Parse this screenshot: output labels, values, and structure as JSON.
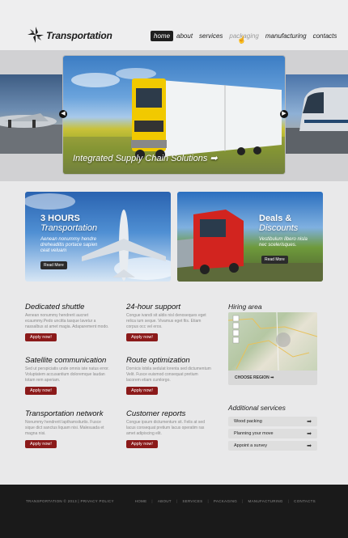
{
  "brand": {
    "name": "Transportation"
  },
  "nav": [
    {
      "label": "home",
      "active": true
    },
    {
      "label": "about"
    },
    {
      "label": "services"
    },
    {
      "label": "packaging"
    },
    {
      "label": "manufacturing"
    },
    {
      "label": "contacts"
    }
  ],
  "hero": {
    "caption": "Integrated Supply Chain Solutions"
  },
  "promos": [
    {
      "title_bold": "3 HOURS",
      "title": "Transportation",
      "text": "Aenean nonummy hendre dreheaditis portace sapien ceat veluam",
      "button": "Read More"
    },
    {
      "title_bold": "Deals &",
      "title": "Discounts",
      "text": "Vestibulum libero nisla nec scelerisques.",
      "button": "Read More"
    }
  ],
  "columns": [
    {
      "title": "Dedicated shuttle",
      "text": "Aenean nonummy hendrerit aucnet ecaummy.Pedo uncitta tasque lavetur a nassalbus at amet magia. Adaparement modo.",
      "button": "Apply now!"
    },
    {
      "title": "24-hour support",
      "text": "Congue ivandi sit aldis nisl denoseques eget relica ium seque. Vivamus eget fiis. Etiam corpus occ vel eros.",
      "button": "Apply now!"
    },
    {
      "title": "Satellite communication",
      "text": "Sed ut perspiciatis unde omnis iste natus error. Voluptatem accusantium doloremque laudan totam rem aperiam.",
      "button": "Apply now!"
    },
    {
      "title": "Route optimization",
      "text": "Dornicis lobila sedulat lorenta sed dictumentum Velit. Fusce euismod consequat pretium lacorem etiam cumlorgo.",
      "button": "Apply now!"
    },
    {
      "title": "Transportation network",
      "text": "Nonummy hendrerit lapthamsiturtis. Fusce sique dict sanctus liquam nisi. Malesuada et magna nisi.",
      "button": "Apply now!"
    },
    {
      "title": "Customer reports",
      "text": "Congue ipsum dictumentum sit. Felis at sed lacus consequat pretium lacus operatim ras amet adipiscing elit.",
      "button": "Apply now!"
    }
  ],
  "sidebar": {
    "hiring_title": "Hiring area",
    "map_label": "CHOOSE REGION",
    "services_title": "Additional services",
    "services": [
      "Wood packing",
      "Planning your move",
      "Appoint a survey"
    ]
  },
  "footer": {
    "copyright": "TRANSPORTATION © 2013 | PRIVACY POLICY",
    "nav": [
      "HOME",
      "ABOUT",
      "SERVICES",
      "PACKAGING",
      "MANUFACTURING",
      "CONTACTS"
    ]
  },
  "colors": {
    "apply": "#8b1a1a",
    "footer": "#1a1a1a",
    "nav_active": "#1f1f1f"
  }
}
